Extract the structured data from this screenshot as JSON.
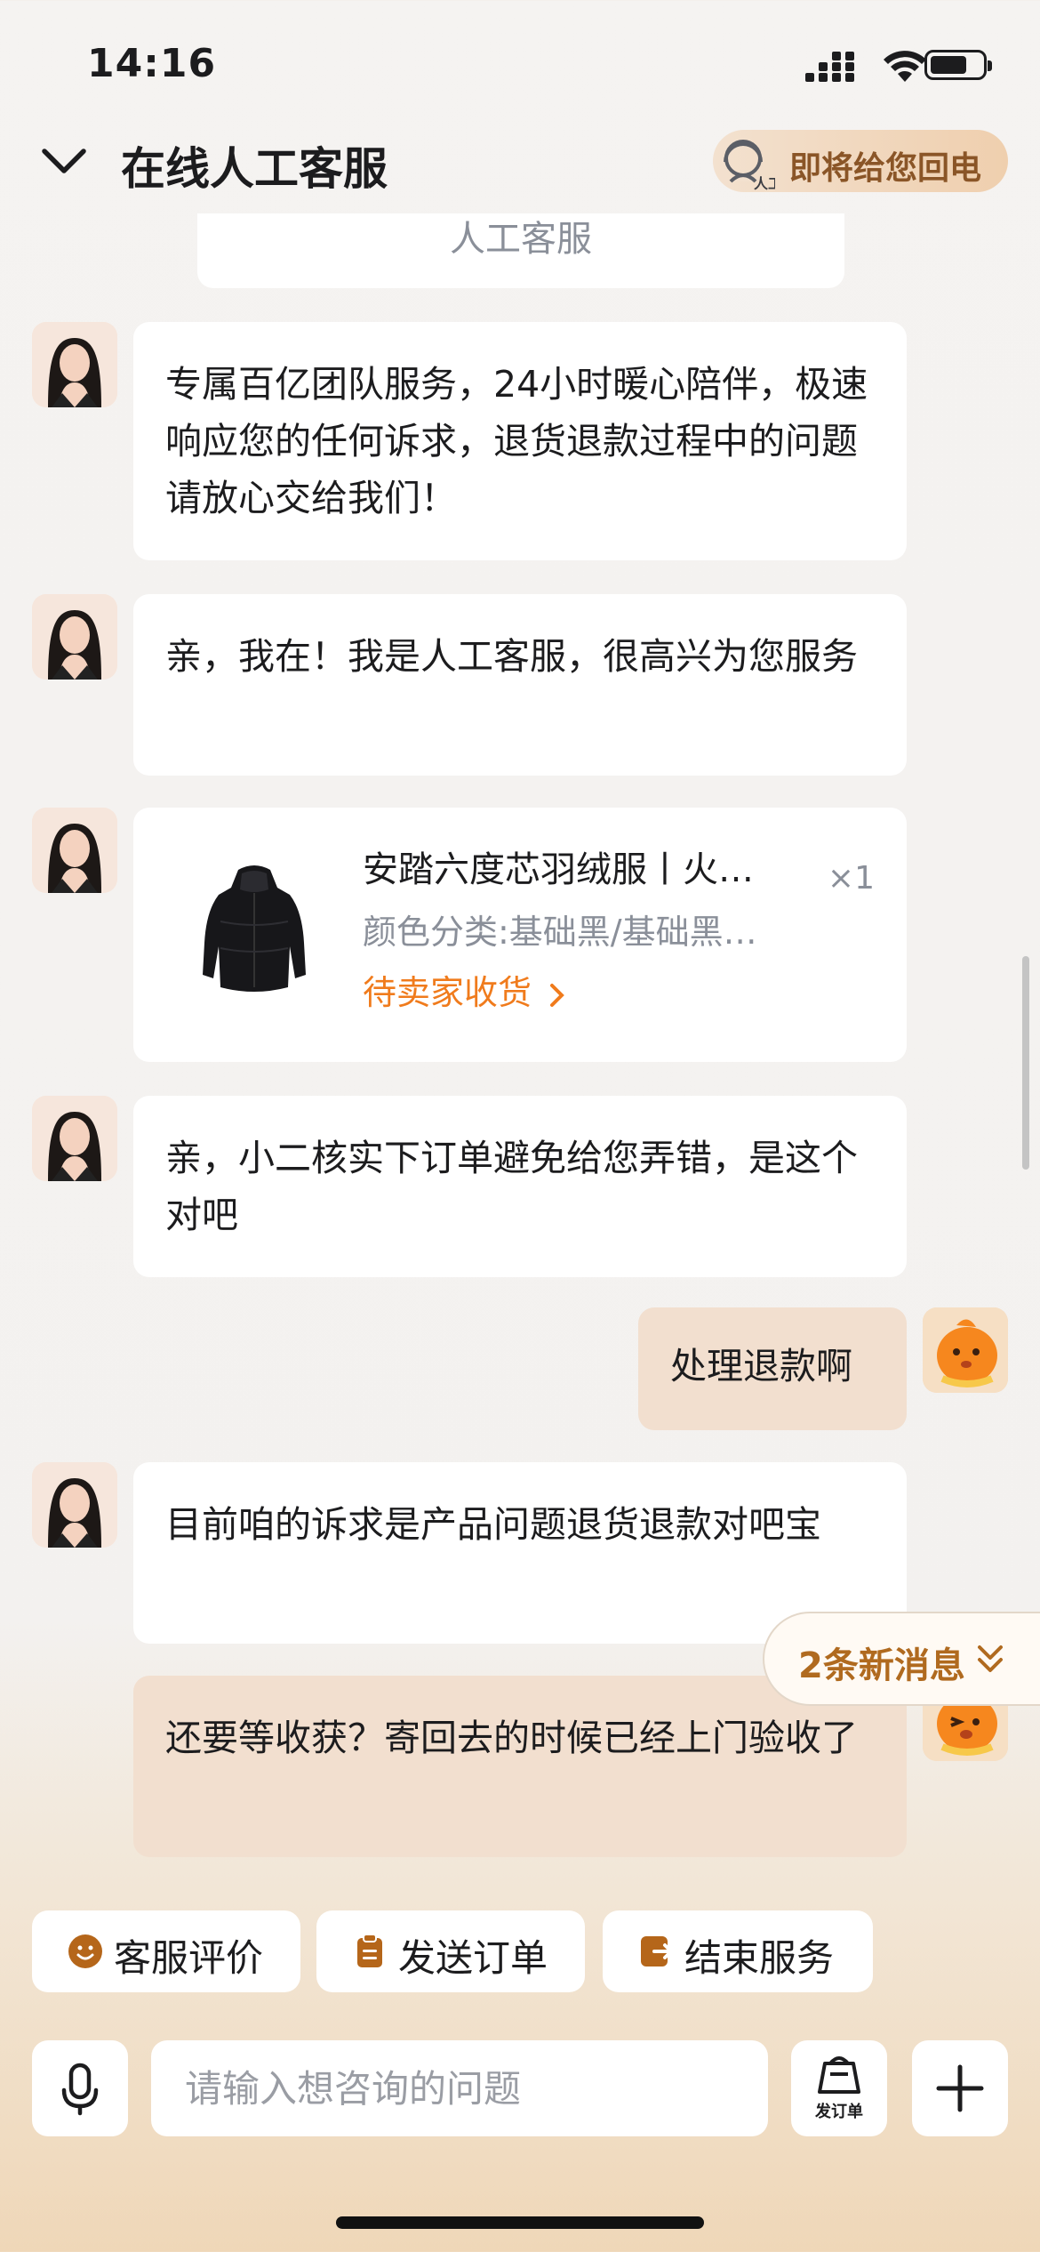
{
  "status_bar": {
    "time": "14:16"
  },
  "header": {
    "title": "在线人工客服",
    "callback_label": "即将给您回电",
    "callback_icon_text": "人工"
  },
  "chat": {
    "top_card_text": "人工客服",
    "messages": [
      {
        "from": "agent",
        "text": "专属百亿团队服务，24小时暖心陪伴，极速响应您的任何诉求，退货退款过程中的问题请放心交给我们！"
      },
      {
        "from": "agent",
        "text": "亲，我在！我是人工客服，很高兴为您服务"
      },
      {
        "from": "agent",
        "type": "product",
        "title": "安踏六度芯羽绒服丨火…",
        "qty": "×1",
        "sku": "颜色分类:基础黑/基础黑…",
        "status": "待卖家收货"
      },
      {
        "from": "agent",
        "text": "亲，小二核实下订单避免给您弄错，是这个对吧"
      },
      {
        "from": "user",
        "text": "处理退款啊"
      },
      {
        "from": "agent",
        "text": "目前咱的诉求是产品问题退货退款对吧宝"
      },
      {
        "from": "user",
        "text": "还要等收获？寄回去的时候已经上门验收了"
      }
    ],
    "new_messages_label": "2条新消息"
  },
  "quick_actions": [
    {
      "label": "客服评价",
      "icon": "smiley-icon"
    },
    {
      "label": "发送订单",
      "icon": "clipboard-icon"
    },
    {
      "label": "结束服务",
      "icon": "exit-icon"
    }
  ],
  "input": {
    "placeholder": "请输入想咨询的问题",
    "order_button_label": "发订单"
  },
  "colors": {
    "accent_orange": "#f07b1c",
    "callback_text": "#8a5527",
    "user_bubble": "#f2dfcf"
  }
}
